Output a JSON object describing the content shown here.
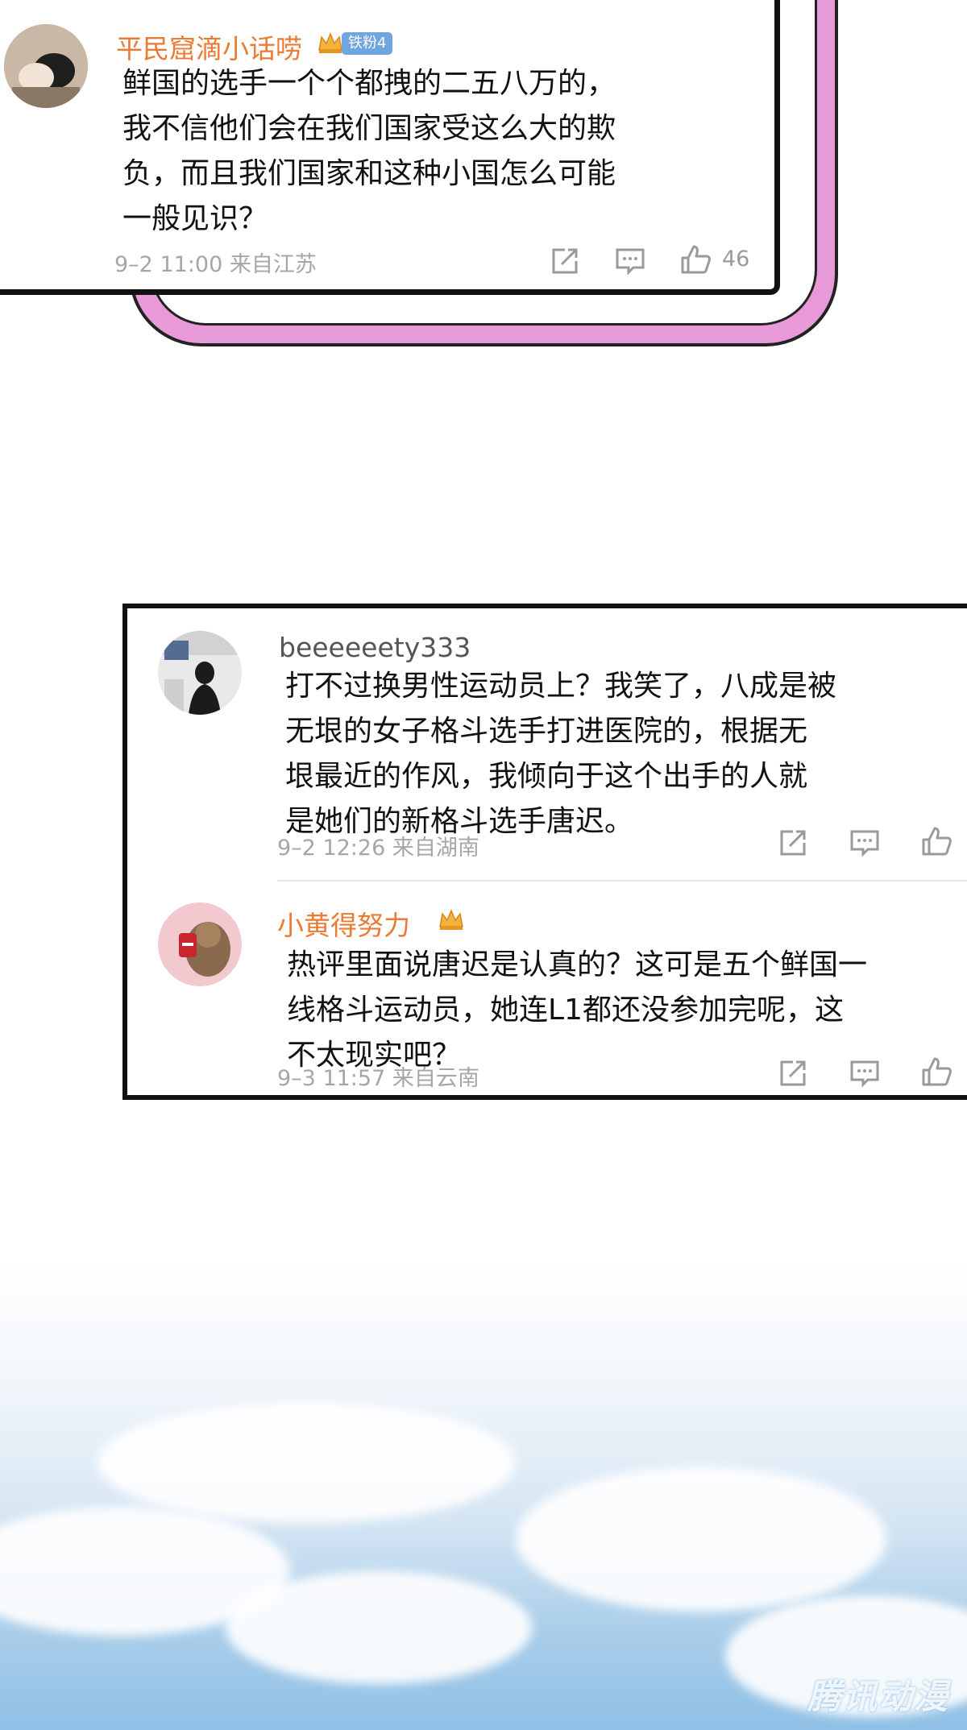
{
  "comments": [
    {
      "username": "平民窟滴小话唠",
      "fan_badge": "铁粉4",
      "text_lines": [
        "鲜国的选手一个个都拽的二五八万的，",
        "我不信他们会在我们国家受这么大的欺",
        "负，而且我们国家和这种小国怎么可能",
        "一般见识？"
      ],
      "meta": "9–2 11:00  来自江苏",
      "likes": "46"
    },
    {
      "username": "beeeeeety333",
      "text_lines": [
        "打不过换男性运动员上？我笑了，八成是被",
        "无垠的女子格斗选手打进医院的，根据无",
        "垠最近的作风，我倾向于这个出手的人就",
        "是她们的新格斗选手唐迟。"
      ],
      "meta": "9–2 12:26  来自湖南"
    },
    {
      "username": "小黄得努力",
      "text_lines": [
        "热评里面说唐迟是认真的？这可是五个鲜国一",
        "线格斗运动员，她连L1都还没参加完呢，这",
        "不太现实吧？"
      ],
      "meta": "9–3 11:57  来自云南"
    }
  ],
  "watermark": "腾讯动漫",
  "colors": {
    "username_orange": "#eb7a32",
    "frame_pink": "#e89ad8",
    "sky_blue": "#8fc0e6"
  },
  "icons": [
    "share-icon",
    "comment-icon",
    "like-icon",
    "crown-icon"
  ]
}
